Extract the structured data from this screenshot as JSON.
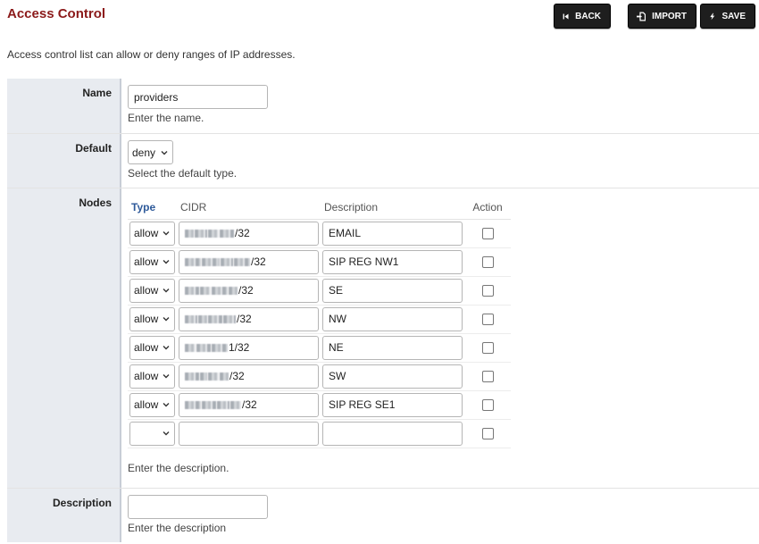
{
  "page": {
    "title": "Access Control",
    "intro": "Access control list can allow or deny ranges of IP addresses."
  },
  "toolbar": {
    "back_label": "BACK",
    "import_label": "IMPORT",
    "save_label": "SAVE"
  },
  "form": {
    "name": {
      "label": "Name",
      "value": "providers",
      "hint": "Enter the name."
    },
    "default": {
      "label": "Default",
      "value": "deny",
      "hint": "Select the default type."
    },
    "nodes": {
      "label": "Nodes",
      "columns": {
        "type": "Type",
        "cidr": "CIDR",
        "description": "Description",
        "action": "Action"
      },
      "rows": [
        {
          "type": "allow",
          "cidr_suffix": "/32",
          "description": "EMAIL"
        },
        {
          "type": "allow",
          "cidr_suffix": "/32",
          "description": "SIP REG NW1"
        },
        {
          "type": "allow",
          "cidr_suffix": "/32",
          "description": "SE"
        },
        {
          "type": "allow",
          "cidr_suffix": "/32",
          "description": "NW"
        },
        {
          "type": "allow",
          "cidr_suffix": "1/32",
          "description": "NE"
        },
        {
          "type": "allow",
          "cidr_suffix": "/32",
          "description": "SW"
        },
        {
          "type": "allow",
          "cidr_suffix": "/32",
          "description": "SIP REG SE1"
        },
        {
          "type": "",
          "cidr_suffix": "",
          "description": ""
        }
      ],
      "hint": "Enter the description."
    },
    "description": {
      "label": "Description",
      "value": "",
      "hint": "Enter the description"
    }
  },
  "icons": {
    "back": "skip-back-icon",
    "import": "file-import-icon",
    "save": "lightning-bolt-icon",
    "dropdown": "chevron-down-icon"
  },
  "colors": {
    "title": "#8b1a1a",
    "button_bg": "#1e1e1e",
    "label_bg": "#e8ebf0",
    "sorted_column": "#2e5a9a"
  }
}
